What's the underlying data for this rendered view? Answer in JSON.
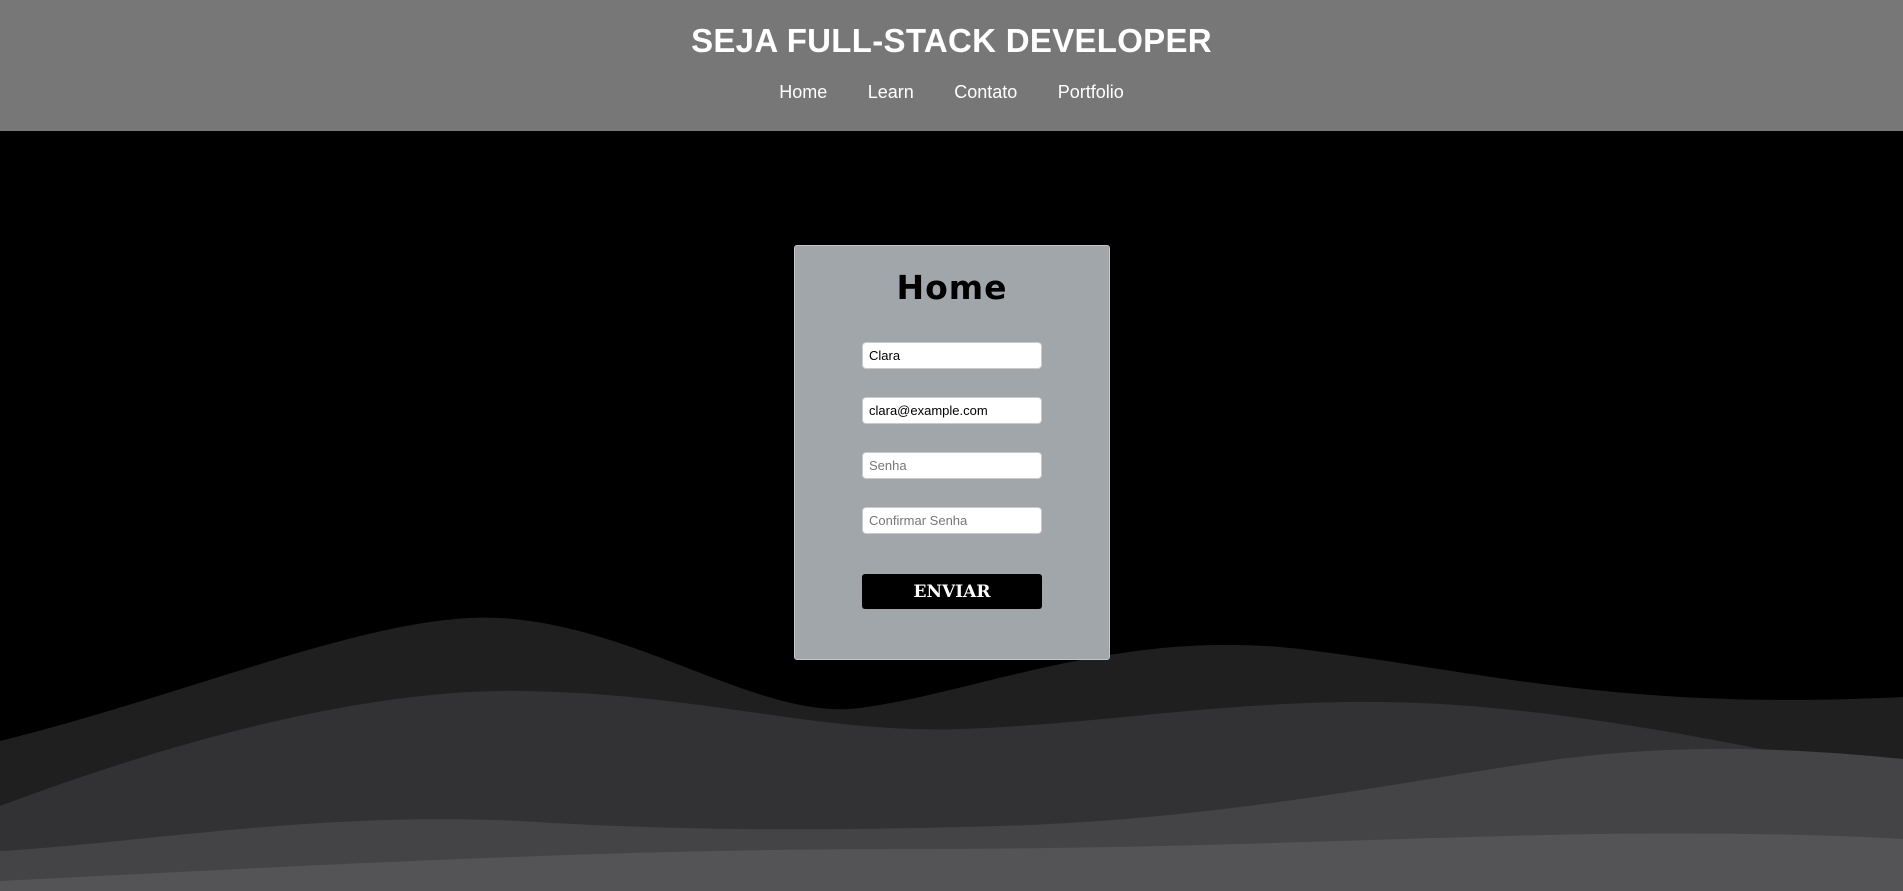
{
  "header": {
    "title": "SEJA FULL-STACK DEVELOPER",
    "nav": [
      "Home",
      "Learn",
      "Contato",
      "Portfolio"
    ]
  },
  "form": {
    "title": "Home",
    "name_value": "Clara",
    "email_value": "clara@example.com",
    "password_placeholder": "Senha",
    "confirm_placeholder": "Confirmar Senha",
    "submit_label": "ENVIAR"
  },
  "colors": {
    "header_bg": "#777777",
    "page_bg": "#000000",
    "card_bg": "#a1a6aa",
    "wave_layers": [
      "#1f1f20",
      "#323234",
      "#444446",
      "#545456"
    ]
  }
}
